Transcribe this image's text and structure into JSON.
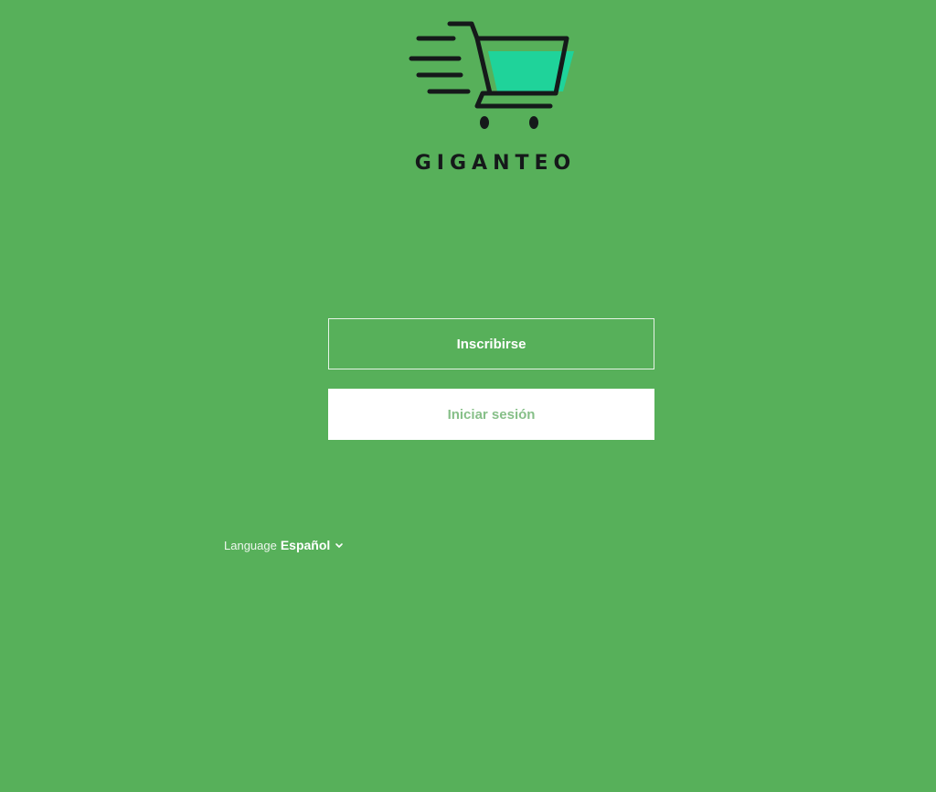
{
  "brand": {
    "name": "GIGANTEO",
    "logo_icon": "shopping-cart-icon",
    "cart_fill_color": "#1fd39a",
    "ink_color": "#15191a"
  },
  "actions": {
    "signup_label": "Inscribirse",
    "login_label": "Iniciar sesión"
  },
  "language": {
    "label": "Language",
    "selected": "Español",
    "chevron_icon": "chevron-down-icon"
  },
  "theme": {
    "background": "#57b05a",
    "login_text_color": "#86bf88"
  }
}
